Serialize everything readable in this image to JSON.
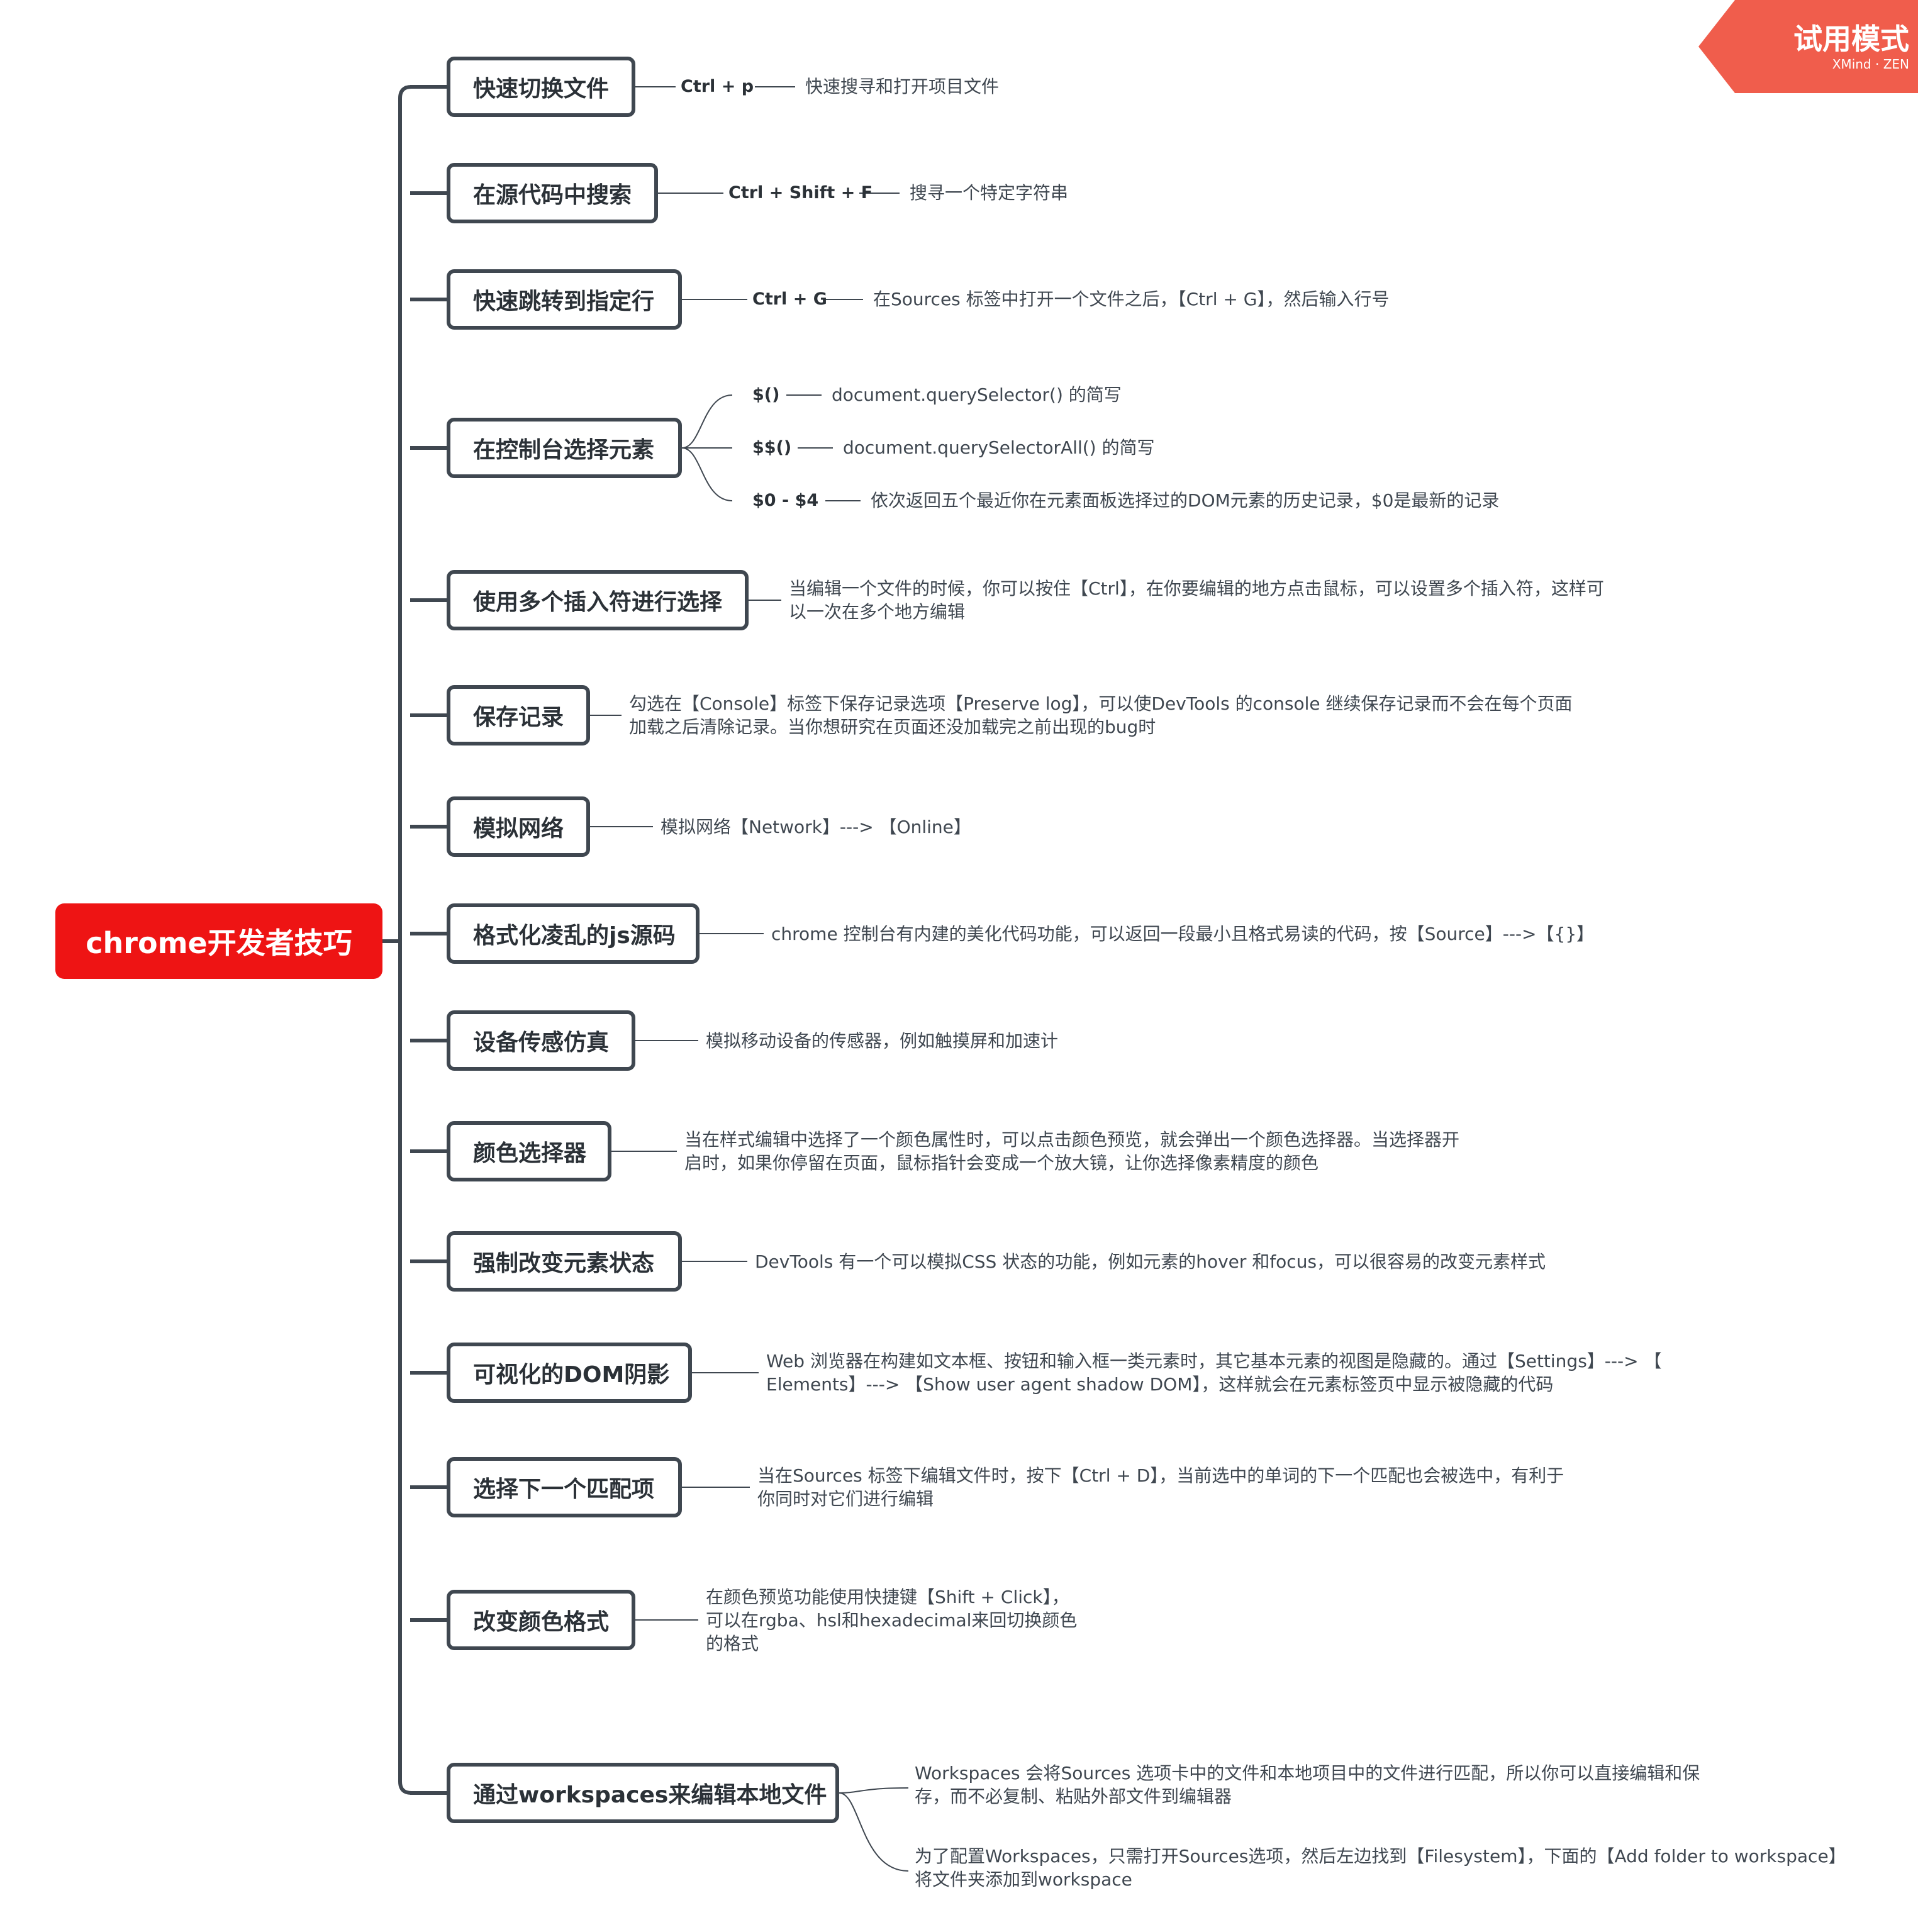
{
  "badge": {
    "title": "试用模式",
    "subtitle": "XMind · ZEN"
  },
  "colors": {
    "root": "#ee1414",
    "line": "#3f4750",
    "badge": "#f05d4c"
  },
  "root": {
    "label": "chrome开发者技巧"
  },
  "topics": [
    {
      "label": "快速切换文件",
      "key": "Ctrl + p",
      "details": [
        "快速搜寻和打开项目文件"
      ]
    },
    {
      "label": "在源代码中搜索",
      "key": "Ctrl + Shift + F",
      "details": [
        "搜寻一个特定字符串"
      ]
    },
    {
      "label": "快速跳转到指定行",
      "key": "Ctrl + G",
      "details": [
        "在Sources 标签中打开一个文件之后，【Ctrl + G】，然后输入行号"
      ]
    },
    {
      "label": "在控制台选择元素",
      "subtopics": [
        {
          "key": "$()",
          "detail": "document.querySelector() 的简写"
        },
        {
          "key": "$$()",
          "detail": "document.querySelectorAll() 的简写"
        },
        {
          "key": "$0 - $4",
          "detail": "依次返回五个最近你在元素面板选择过的DOM元素的历史记录，$0是最新的记录"
        }
      ]
    },
    {
      "label": "使用多个插入符进行选择",
      "details": [
        "当编辑一个文件的时候，你可以按住【Ctrl】，在你要编辑的地方点击鼠标，可以设置多个插入符，这样可",
        "以一次在多个地方编辑"
      ]
    },
    {
      "label": "保存记录",
      "details": [
        "勾选在【Console】标签下保存记录选项【Preserve log】，可以使DevTools 的console 继续保存记录而不会在每个页面",
        "加载之后清除记录。当你想研究在页面还没加载完之前出现的bug时"
      ]
    },
    {
      "label": "模拟网络",
      "details": [
        "模拟网络【Network】---> 【Online】"
      ]
    },
    {
      "label": "格式化凌乱的js源码",
      "details": [
        "chrome 控制台有内建的美化代码功能，可以返回一段最小且格式易读的代码，按【Source】--->【{}】"
      ]
    },
    {
      "label": "设备传感仿真",
      "details": [
        "模拟移动设备的传感器，例如触摸屏和加速计"
      ]
    },
    {
      "label": "颜色选择器",
      "details": [
        "当在样式编辑中选择了一个颜色属性时，可以点击颜色预览，就会弹出一个颜色选择器。当选择器开",
        "启时，如果你停留在页面，鼠标指针会变成一个放大镜，让你选择像素精度的颜色"
      ]
    },
    {
      "label": "强制改变元素状态",
      "details": [
        "DevTools 有一个可以模拟CSS 状态的功能，例如元素的hover 和focus，可以很容易的改变元素样式"
      ]
    },
    {
      "label": "可视化的DOM阴影",
      "details": [
        "Web 浏览器在构建如文本框、按钮和输入框一类元素时，其它基本元素的视图是隐藏的。通过【Settings】---> 【",
        "Elements】---> 【Show user agent shadow DOM】，这样就会在元素标签页中显示被隐藏的代码"
      ]
    },
    {
      "label": "选择下一个匹配项",
      "details": [
        "当在Sources 标签下编辑文件时，按下【Ctrl + D】，当前选中的单词的下一个匹配也会被选中，有利于",
        "你同时对它们进行编辑"
      ]
    },
    {
      "label": "改变颜色格式",
      "details": [
        "在颜色预览功能使用快捷键【Shift + Click】，",
        "可以在rgba、hsl和hexadecimal来回切换颜色",
        "的格式"
      ]
    },
    {
      "label": "通过workspaces来编辑本地文件",
      "subnotes": [
        [
          "Workspaces 会将Sources 选项卡中的文件和本地项目中的文件进行匹配，所以你可以直接编辑和保",
          "存，而不必复制、粘贴外部文件到编辑器"
        ],
        [
          "为了配置Workspaces，只需打开Sources选项，然后左边找到【Filesystem】，下面的【Add folder to workspace】",
          "将文件夹添加到workspace"
        ]
      ]
    }
  ]
}
